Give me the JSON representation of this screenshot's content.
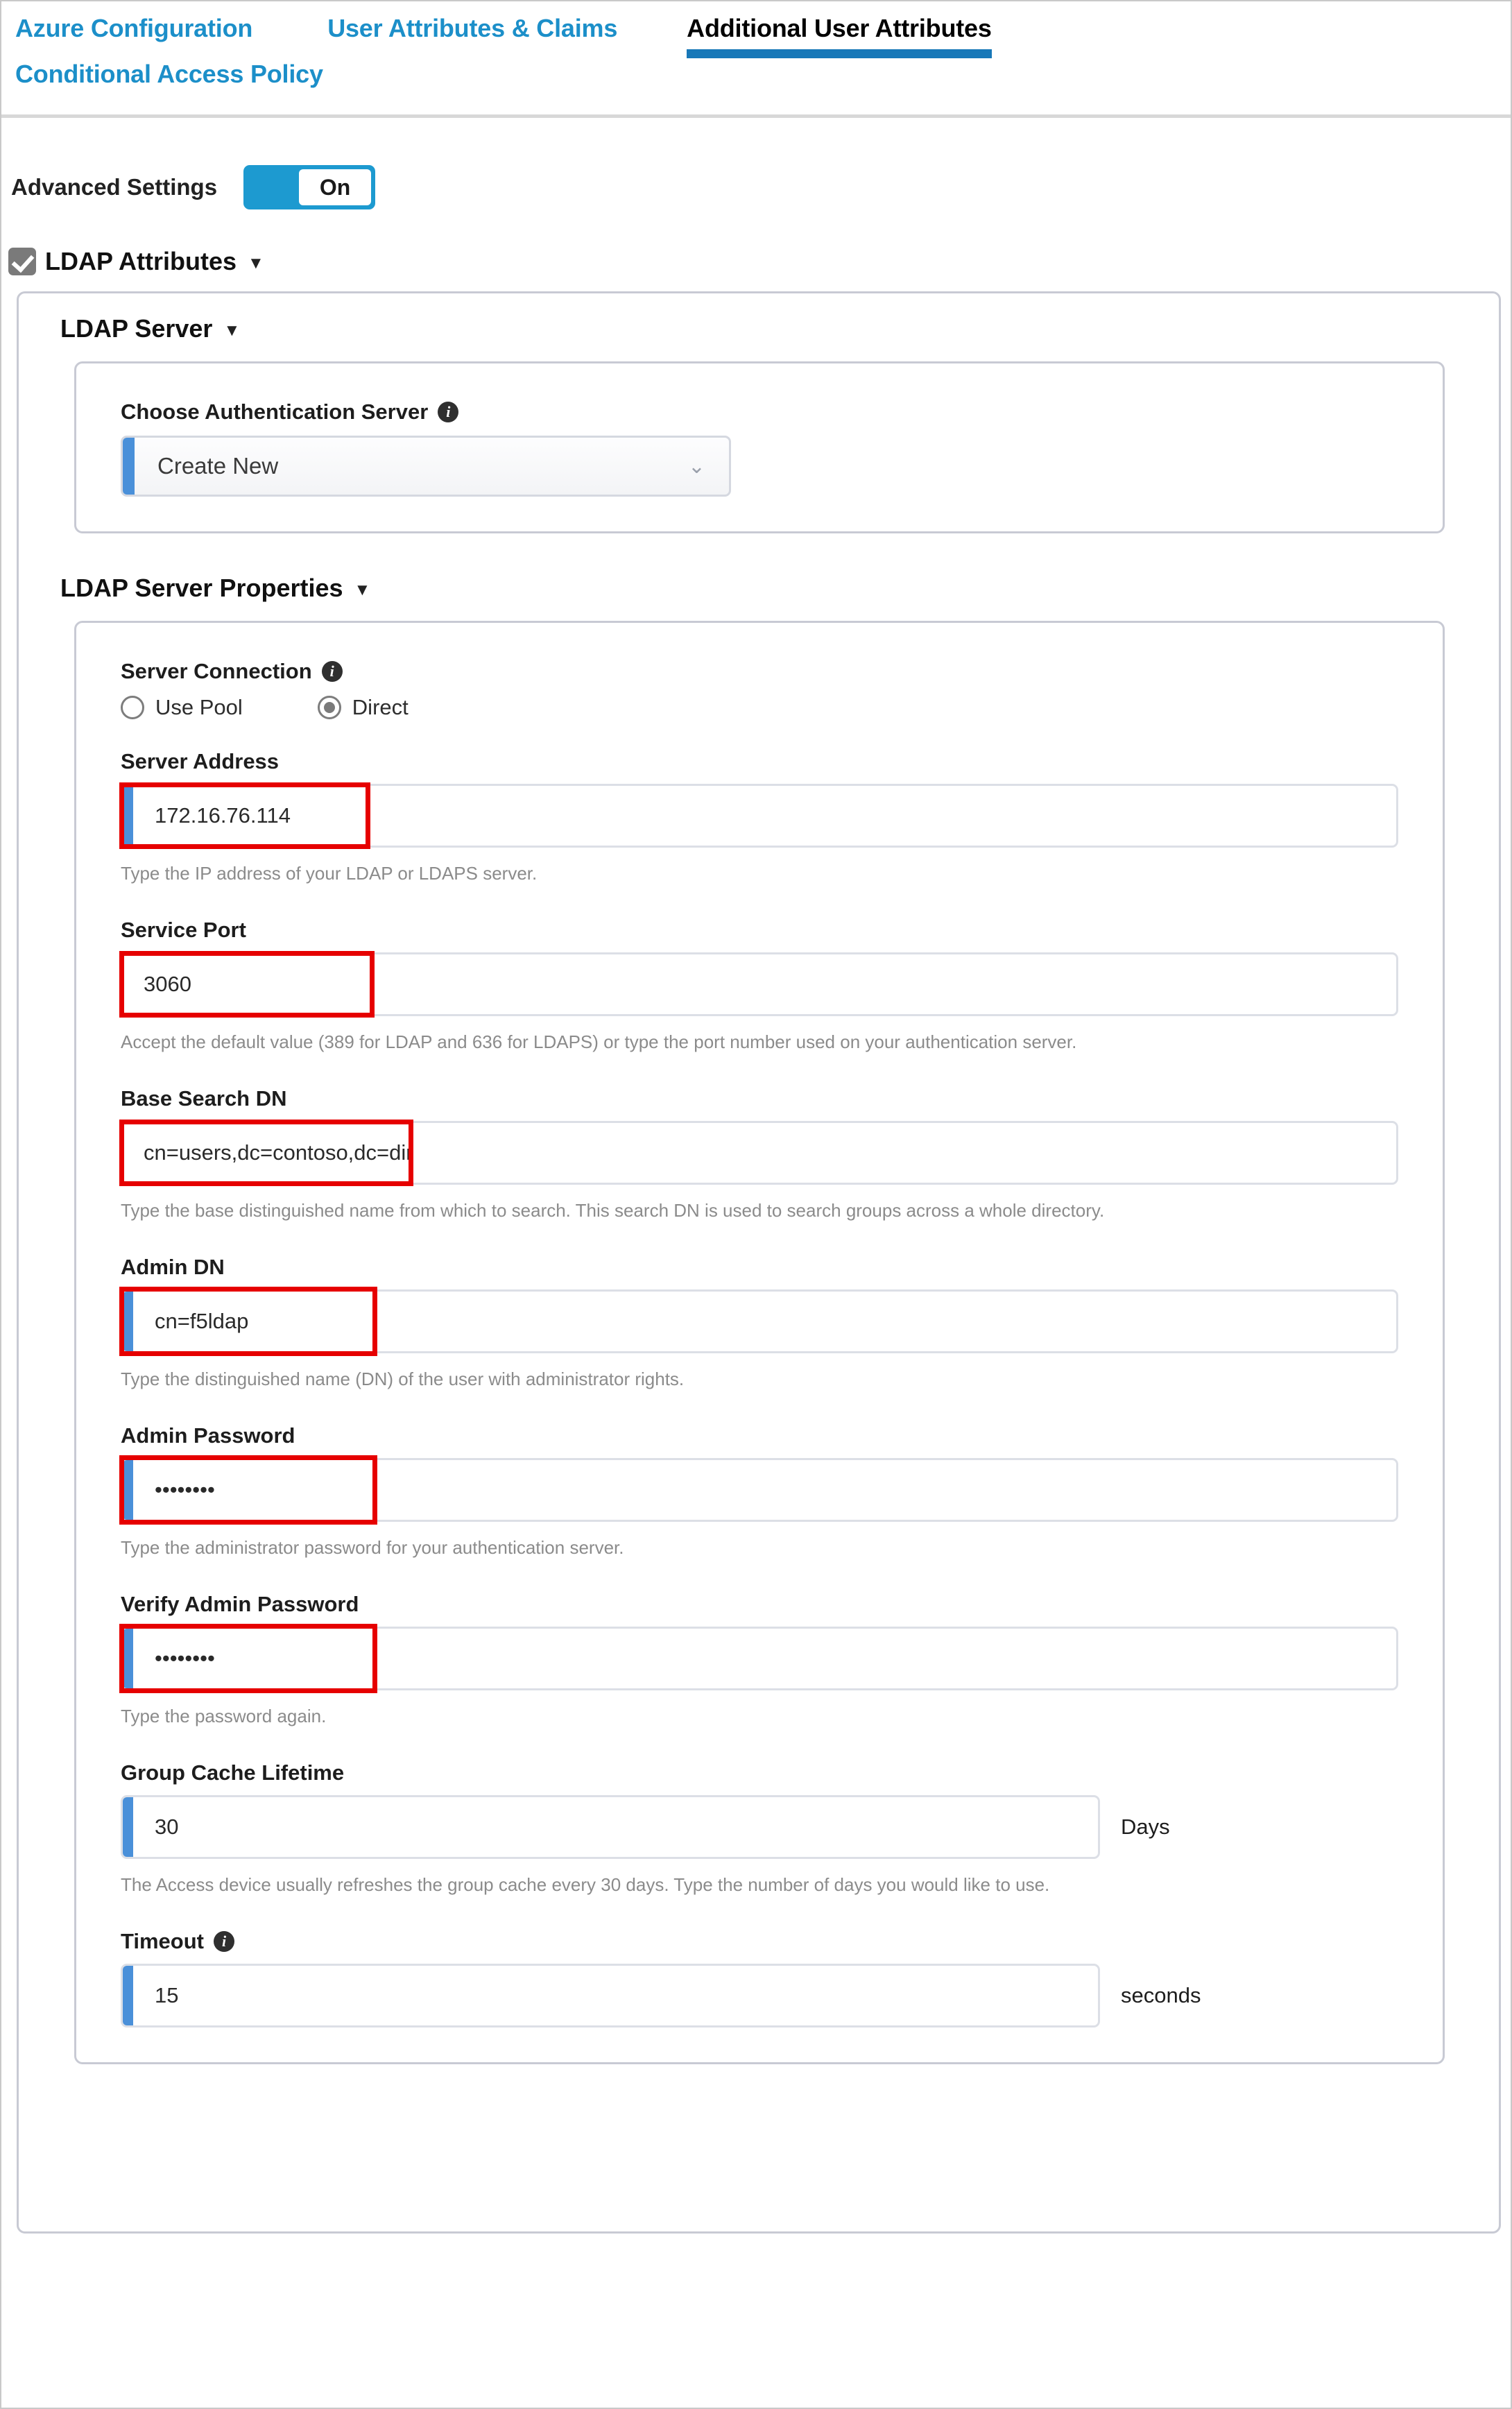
{
  "tabs": [
    {
      "label": "Azure Configuration",
      "active": false
    },
    {
      "label": "User Attributes & Claims",
      "active": false
    },
    {
      "label": "Additional User Attributes",
      "active": true
    },
    {
      "label": "Conditional Access Policy",
      "active": false
    }
  ],
  "advanced_settings": {
    "label": "Advanced Settings",
    "toggle_state": "On"
  },
  "ldap_attributes": {
    "title": "LDAP Attributes",
    "checked": true,
    "caret": "▼"
  },
  "ldap_server": {
    "title": "LDAP Server",
    "caret": "▼",
    "auth_server": {
      "label": "Choose Authentication Server",
      "info": "i",
      "value": "Create New",
      "caret": "⌄"
    }
  },
  "ldap_server_properties": {
    "title": "LDAP Server Properties",
    "caret": "▼",
    "server_connection": {
      "label": "Server Connection",
      "info": "i",
      "options": [
        {
          "label": "Use Pool",
          "selected": false
        },
        {
          "label": "Direct",
          "selected": true
        }
      ]
    },
    "fields": [
      {
        "label": "Server Address",
        "value": "172.16.76.114",
        "help": "Type the IP address of your LDAP or LDAPS server."
      },
      {
        "label": "Service Port",
        "value": "3060",
        "help": "Accept the default value (389 for LDAP and 636 for LDAPS) or type the port number used on your authentication server."
      },
      {
        "label": "Base Search DN",
        "value": "cn=users,dc=contoso,dc=dir",
        "help": "Type the base distinguished name from which to search. This search DN is used to search groups across a whole directory."
      },
      {
        "label": "Admin DN",
        "value": "cn=f5ldap",
        "help": "Type the distinguished name (DN) of the user with administrator rights."
      },
      {
        "label": "Admin Password",
        "value": "••••••••",
        "help": "Type the administrator password for your authentication server."
      },
      {
        "label": "Verify Admin Password",
        "value": "••••••••",
        "help": "Type the password again."
      },
      {
        "label": "Group Cache Lifetime",
        "value": "30",
        "suffix": "Days",
        "help": "The Access device usually refreshes the group cache every 30 days. Type the number of days you would like to use."
      },
      {
        "label": "Timeout",
        "info": "i",
        "value": "15",
        "suffix": "seconds"
      }
    ]
  },
  "colors": {
    "accent_blue": "#1878b8",
    "link_blue": "#1c8fc9",
    "toggle_blue": "#1d9ad0",
    "field_accent": "#4a90d9",
    "annotation_red": "#e60000",
    "help_grey": "#8b8b8b"
  }
}
